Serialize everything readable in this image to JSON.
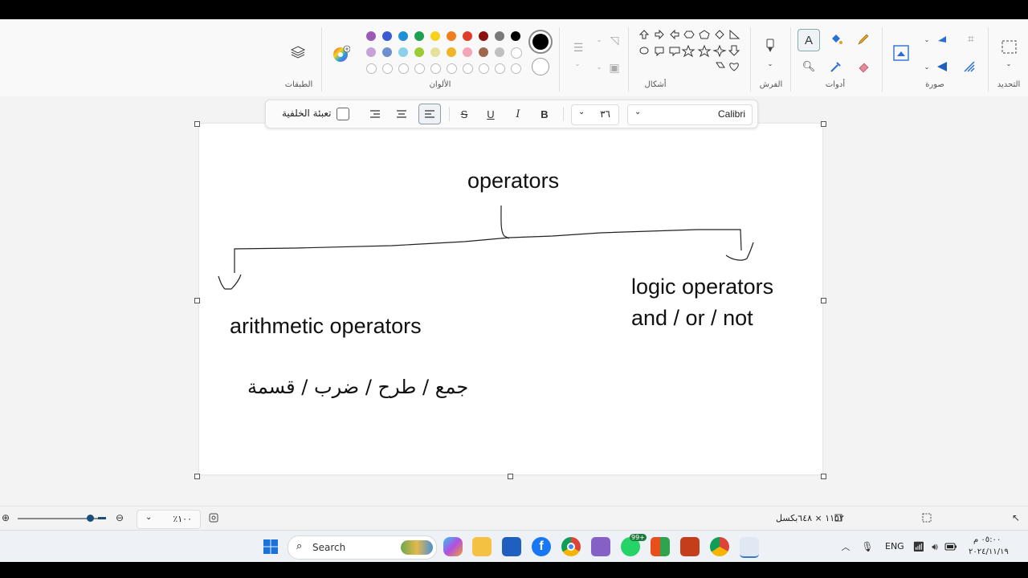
{
  "ribbon": {
    "groups": {
      "selection": "التحديد",
      "image": "صورة",
      "tools": "أدوات",
      "brushes": "الفرش",
      "shapes": "أشكال",
      "colors": "الألوان",
      "layers": "الطبقات"
    },
    "colors_row1": [
      "#000000",
      "#7a7a7a",
      "#8b1010",
      "#e03a2a",
      "#f07d1e",
      "#f6d21c",
      "#1ea050",
      "#1f8fd6",
      "#3b5bd2",
      "#9b59b6"
    ],
    "colors_row2": [
      "#ffffff",
      "#c0c0c0",
      "#a0684a",
      "#f4a6b8",
      "#f0b429",
      "#e8e09a",
      "#9ccc34",
      "#8ad0e8",
      "#6d8fcf",
      "#c6a2d8"
    ],
    "active_color": "#000000"
  },
  "text_toolbar": {
    "font": "Calibri",
    "size": "٣٦",
    "bold": "B",
    "italic": "I",
    "underline": "U",
    "strike": "S",
    "fill_label": "تعبئة الخلفية"
  },
  "canvas": {
    "t1": "operators",
    "t2": "arithmetic operators",
    "t3": "logic operators",
    "t4": "and / or / not",
    "t5": "جمع / طرح / ضرب / قسمة"
  },
  "status": {
    "zoom": "٪١٠٠",
    "dims": "١١٥٢ × ٦٤٨بكسل"
  },
  "taskbar": {
    "search": "Search",
    "lang": "ENG",
    "time": "٠٥:٠٠ م",
    "date": "٢٠٢٤/١١/١٩",
    "badge": "99+"
  }
}
